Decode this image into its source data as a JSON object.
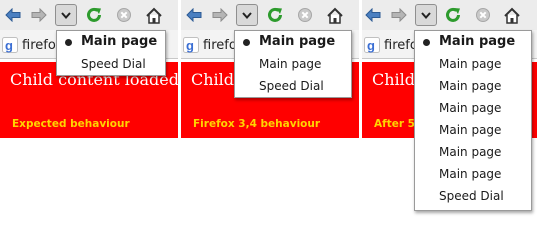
{
  "panels": [
    {
      "tab_title": "firefox",
      "headline": "Child content loaded",
      "caption": "Expected behaviour",
      "menu": [
        {
          "label": "Main page",
          "selected": true
        },
        {
          "label": "Speed Dial",
          "selected": false
        }
      ]
    },
    {
      "tab_title": "firefox",
      "headline": "Child",
      "caption": "Firefox 3,4 behaviour",
      "menu": [
        {
          "label": "Main page",
          "selected": true
        },
        {
          "label": "Main page",
          "selected": false
        },
        {
          "label": "Speed Dial",
          "selected": false
        }
      ]
    },
    {
      "tab_title": "firefox",
      "headline": "Child",
      "caption": "After 5 refresh (F5)",
      "menu": [
        {
          "label": "Main page",
          "selected": true
        },
        {
          "label": "Main page",
          "selected": false
        },
        {
          "label": "Main page",
          "selected": false
        },
        {
          "label": "Main page",
          "selected": false
        },
        {
          "label": "Main page",
          "selected": false
        },
        {
          "label": "Main page",
          "selected": false
        },
        {
          "label": "Main page",
          "selected": false
        },
        {
          "label": "Speed Dial",
          "selected": false
        }
      ]
    }
  ],
  "icons": {
    "back": "back-arrow-icon",
    "forward": "forward-arrow-icon",
    "history_dropdown": "chevron-down-icon",
    "reload": "reload-icon",
    "stop": "stop-icon",
    "home": "home-icon",
    "favicon": "google-favicon-icon"
  },
  "colors": {
    "content_background": "#ff0000",
    "caption_text": "#ffd400",
    "headline_text": "#ffffff"
  }
}
